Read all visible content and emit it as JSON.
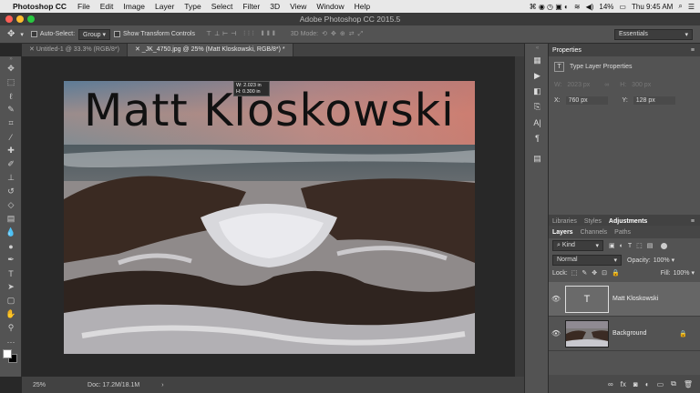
{
  "menubar": {
    "app": "Photoshop CC",
    "items": [
      "File",
      "Edit",
      "Image",
      "Layer",
      "Type",
      "Select",
      "Filter",
      "3D",
      "View",
      "Window",
      "Help"
    ],
    "battery": "14%",
    "datetime": "Thu 9:45 AM"
  },
  "window": {
    "title": "Adobe Photoshop CC 2015.5"
  },
  "options": {
    "auto_select_label": "Auto-Select:",
    "auto_select_value": "Group",
    "show_transform_label": "Show Transform Controls",
    "mode_label": "3D Mode:",
    "workspace": "Essentials"
  },
  "tabs": [
    {
      "label": "Untitled-1 @ 33.3% (RGB/8*)"
    },
    {
      "label": "_JK_4750.jpg @ 25% (Matt Kloskowski, RGB/8*) *"
    }
  ],
  "canvas": {
    "overlay_text": "Matt Kloskowski",
    "measure_w": "W: 2.023 in",
    "measure_h": "H: 0.300 in"
  },
  "status": {
    "zoom": "25%",
    "doc": "Doc: 17.2M/18.1M"
  },
  "properties": {
    "title": "Properties",
    "kind": "Type Layer Properties",
    "w_label": "W:",
    "w_value": "2023 px",
    "h_label": "H:",
    "h_value": "300 px",
    "x_label": "X:",
    "x_value": "760 px",
    "y_label": "Y:",
    "y_value": "128 px"
  },
  "panel_tabs_top": [
    "Libraries",
    "Styles",
    "Adjustments"
  ],
  "panel_tabs_layers": [
    "Layers",
    "Channels",
    "Paths"
  ],
  "layers_panel": {
    "filter_kind": "Kind",
    "blend_mode": "Normal",
    "opacity_label": "Opacity:",
    "opacity_value": "100%",
    "lock_label": "Lock:",
    "fill_label": "Fill:",
    "fill_value": "100%",
    "layers": [
      {
        "name": "Matt Kloskowski",
        "type": "text"
      },
      {
        "name": "Background",
        "type": "image"
      }
    ]
  },
  "colors": {
    "ui_bg": "#535353",
    "canvas_bg": "#282828",
    "accent": "#1473e6"
  }
}
